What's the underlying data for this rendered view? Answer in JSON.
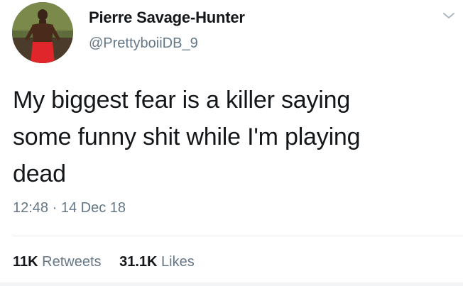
{
  "user": {
    "display_name": "Pierre Savage-Hunter",
    "handle": "@PrettyboiiDB_9",
    "avatar_icon": "user-avatar-photo"
  },
  "tweet": {
    "text_lines": [
      "My biggest fear is a killer saying",
      "some funny shit while I'm playing",
      "dead"
    ],
    "time": "12:48",
    "separator": "·",
    "date": "14 Dec 18"
  },
  "stats": {
    "retweets_count": "11K",
    "retweets_label": "Retweets",
    "likes_count": "31.1K",
    "likes_label": "Likes"
  },
  "colors": {
    "primary_text": "#14171a",
    "secondary_text": "#657786",
    "divider": "#e6ecf0"
  }
}
